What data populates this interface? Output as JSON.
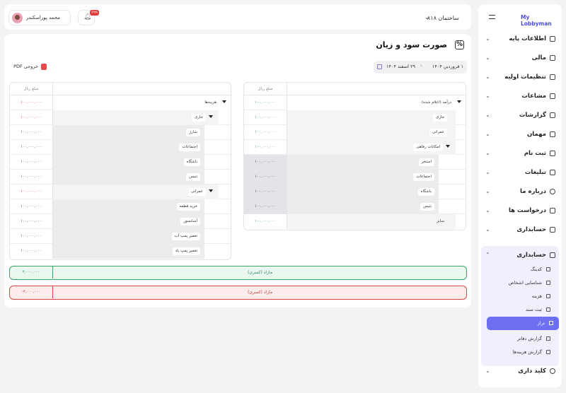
{
  "sidebar": {
    "brand": "My Lobbyman",
    "items": [
      {
        "label": "اطلاعات پایه",
        "icon": "building-icon"
      },
      {
        "label": "مالی",
        "icon": "wallet-icon"
      },
      {
        "label": "تنظیمات اولیه",
        "icon": "settings-icon"
      },
      {
        "label": "مشاعات",
        "icon": "common-areas-icon"
      },
      {
        "label": "گزارشات",
        "icon": "report-icon"
      },
      {
        "label": "مهمان",
        "icon": "guest-icon"
      },
      {
        "label": "ثبت نام",
        "icon": "register-icon"
      },
      {
        "label": "تبلیغات",
        "icon": "ads-icon"
      },
      {
        "label": "درباره ما",
        "icon": "info-icon"
      },
      {
        "label": "درخواست ها",
        "icon": "request-icon"
      },
      {
        "label": "حسابداری",
        "icon": "accounting-icon"
      },
      {
        "label": "حسابداری",
        "icon": "accounting-icon"
      },
      {
        "label": "کلید داری",
        "icon": "key-icon"
      }
    ],
    "sub_items": [
      {
        "label": "کدینگ"
      },
      {
        "label": "شناسایی اشخاص"
      },
      {
        "label": "هزینه"
      },
      {
        "label": "ثبت سند"
      },
      {
        "label": "تراز"
      },
      {
        "label": "گزارش دفاتر"
      },
      {
        "label": "گزارش هزینه‌ها"
      }
    ]
  },
  "header": {
    "building": "ساختمان ۸۱۸",
    "badge": "۶۹۹",
    "user_name": "محمد پوراسکندر"
  },
  "main": {
    "title": "صورت سود و زیان",
    "date_from": "۱ فروردین ۱۴۰۴",
    "date_to": "۲۹ اسفند ۱۴۰۴",
    "pdf_label": "خروجی PDF"
  },
  "income_table": {
    "amount_header": "مبلغ ریال",
    "rows": [
      {
        "label": "درآمد (اعلام شده)",
        "amount": "۱۰۰,۰۰۰,۰۰۰"
      },
      {
        "label": "جاری",
        "amount": "۱۰۰,۰۰۰,۰۰۰"
      },
      {
        "label": "عمرانی",
        "amount": "۱۰۰,۰۰۰,۰۰۰"
      },
      {
        "label": "امکانات رفاهی",
        "amount": "۱۰۰,۰۰۰,۰۰۰"
      },
      {
        "label": "استخر",
        "amount": "۱۰۰,۰۰۰,۰۰۰"
      },
      {
        "label": "اجتماعات",
        "amount": "۱۰۰,۰۰۰,۰۰۰"
      },
      {
        "label": "باشگاه",
        "amount": "۱۰۰,۰۰۰,۰۰۰"
      },
      {
        "label": "تنیس",
        "amount": "۱۰۰,۰۰۰,۰۰۰"
      },
      {
        "label": "سایر",
        "amount": "۱۰۰,۰۰۰,۰۰۰"
      }
    ]
  },
  "expense_table": {
    "amount_header": "مبلغ ریال",
    "rows": [
      {
        "label": "هزینه‌ها",
        "amount": "۱۰۰,۰۰۰,۰۰۰"
      },
      {
        "label": "جاری",
        "amount": "۱۰۰,۰۰۰,۰۰۰"
      },
      {
        "label": "شارژ",
        "amount": "۱۰۰,۰۰۰,۰۰۰"
      },
      {
        "label": "اجتماعات",
        "amount": "۱۰۰,۰۰۰,۰۰۰"
      },
      {
        "label": "باشگاه",
        "amount": "۱۰۰,۰۰۰,۰۰۰"
      },
      {
        "label": "تنیس",
        "amount": "۱۰۰,۰۰۰,۰۰۰"
      },
      {
        "label": "عمرانی",
        "amount": "۱۰۰,۰۰۰,۰۰۰"
      },
      {
        "label": "خرید قطعه",
        "amount": "۱۰۰,۰۰۰,۰۰۰"
      },
      {
        "label": "آسانسور",
        "amount": "۱۰۰,۰۰۰,۰۰۰"
      },
      {
        "label": "تعمیر پمپ آب",
        "amount": "۱۰۰,۰۰۰,۰۰۰"
      },
      {
        "label": "تعمیر پمپ باد",
        "amount": "۱۰۰,۰۰۰,۰۰۰"
      }
    ]
  },
  "totals": [
    {
      "label": "مازاد (کسری)",
      "amount": "۲,۰۰۰,۰۰۰",
      "status": "positive",
      "color": "#3aa36a"
    },
    {
      "label": "مازاد (کسری)",
      "amount": "-۲,۰۰۰,۰۰۰",
      "status": "negative",
      "color": "#d84545"
    }
  ]
}
